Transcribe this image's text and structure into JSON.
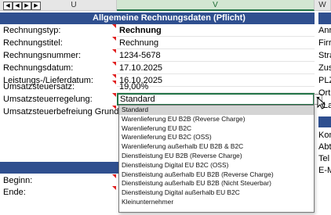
{
  "columns": {
    "u": "U",
    "v": "V",
    "w": "W"
  },
  "nav_buttons": [
    "◀",
    "◀",
    "▶",
    "▶"
  ],
  "banner_title": "Allgemeine Rechnungsdaten (Pflicht)",
  "fields": [
    {
      "label": "Rechnungstyp:",
      "value": "Rechnung",
      "bold": true
    },
    {
      "label": "Rechnungstitel:",
      "value": "Rechnung"
    },
    {
      "label": "Rechnungsnummer:",
      "value": "1234-5678"
    },
    {
      "label": "Rechnungsdatum:",
      "value": "17.10.2025"
    },
    {
      "label": "Leistungs-/Lieferdatum:",
      "value": "16.10.2025"
    },
    {
      "label": "Umsatzsteuersatz:",
      "value": "19,00%"
    },
    {
      "label": "Umsatzsteuerregelung:",
      "value": "Standard"
    },
    {
      "label": "Umsatzsteuerbefreiung Grund:",
      "value": ""
    }
  ],
  "period_labels": {
    "begin": "Beginn:",
    "end": "Ende:"
  },
  "right_column_labels": [
    "Anr",
    "Firr",
    "Stra",
    "Zus",
    "PLZ",
    "Ort",
    "Lan",
    "Kon",
    "Abt",
    "Tel",
    "E-M"
  ],
  "dropdown_options": [
    "Standard",
    "Warenlieferung EU B2B (Reverse Charge)",
    "Warenlieferung EU B2C",
    "Warenlieferung EU B2C (OSS)",
    "Warenlieferung außerhalb EU B2B & B2C",
    "Dienstleistung EU B2B (Reverse Charge)",
    "Dienstleistung Digital EU B2C (OSS)",
    "Dienstleistung außerhalb EU B2B (Reverse Charge)",
    "Dienstleistung außerhalb EU B2B (Nicht Steuerbar)",
    "Dienstleistung Digital außerhalb EU B2C",
    "Kleinunternehmer"
  ],
  "dropdown_selected": "Standard",
  "colors": {
    "banner": "#2f4f8f",
    "selection": "#217346",
    "note_marker": "#e02020"
  }
}
